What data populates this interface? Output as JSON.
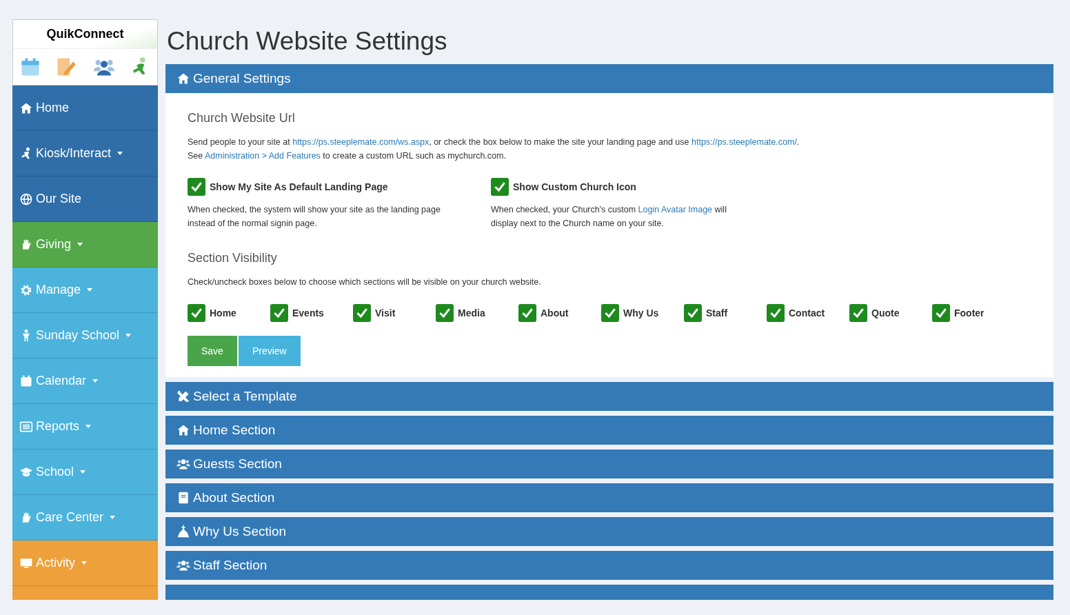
{
  "sidebar": {
    "brand": "QuikConnect",
    "items": [
      {
        "label": "Home",
        "kind": "house",
        "color": "#2f6ea8",
        "dropdown": false
      },
      {
        "label": "Kiosk/Interact",
        "kind": "kneel",
        "color": "#2f6ea8",
        "dropdown": true
      },
      {
        "label": "Our Site",
        "kind": "globe",
        "color": "#2f6ea8",
        "dropdown": false
      },
      {
        "label": "Giving",
        "kind": "hand",
        "color": "#55a84a",
        "dropdown": true
      },
      {
        "label": "Manage",
        "kind": "gear",
        "color": "#4bb3dc",
        "dropdown": true
      },
      {
        "label": "Sunday School",
        "kind": "child",
        "color": "#4bb3dc",
        "dropdown": true
      },
      {
        "label": "Calendar",
        "kind": "calendar",
        "color": "#4bb3dc",
        "dropdown": true
      },
      {
        "label": "Reports",
        "kind": "list",
        "color": "#4bb3dc",
        "dropdown": true
      },
      {
        "label": "School",
        "kind": "cap",
        "color": "#4bb3dc",
        "dropdown": true
      },
      {
        "label": "Care Center",
        "kind": "hand",
        "color": "#4bb3dc",
        "dropdown": true
      },
      {
        "label": "Activity",
        "kind": "monitor",
        "color": "#eea03a",
        "dropdown": true
      }
    ]
  },
  "page_title": "Church Website Settings",
  "general_settings": {
    "title": "General Settings",
    "url_heading": "Church Website Url",
    "url_text_1": "Send people to your site at ",
    "url_link_1": "https://ps.steeplemate.com/ws.aspx",
    "url_text_2": ", or check the box below to make the site your landing page and use ",
    "url_link_2": "https://ps.steeplemate.com/",
    "url_text_3": ".",
    "url_text_4": "See ",
    "url_link_3": "Administration > Add Features",
    "url_text_5": " to create a custom URL such as mychurch.com.",
    "options": [
      {
        "label": "Show My Site As Default Landing Page",
        "checked": true,
        "desc_1": "When checked, the system will show your site as the landing page instead of the normal signin page."
      },
      {
        "label": "Show Custom Church Icon",
        "checked": true,
        "desc_1": "When checked, your Church's custom ",
        "desc_link": "Login Avatar Image",
        "desc_2": " will display next to the Church name on your site."
      }
    ],
    "visibility_heading": "Section Visibility",
    "visibility_text": "Check/uncheck boxes below to choose which sections will be visible on your church website.",
    "sections": [
      {
        "label": "Home",
        "checked": true
      },
      {
        "label": "Events",
        "checked": true
      },
      {
        "label": "Visit",
        "checked": true
      },
      {
        "label": "Media",
        "checked": true
      },
      {
        "label": "About",
        "checked": true
      },
      {
        "label": "Why Us",
        "checked": true
      },
      {
        "label": "Staff",
        "checked": true
      },
      {
        "label": "Contact",
        "checked": true
      },
      {
        "label": "Quote",
        "checked": true
      },
      {
        "label": "Footer",
        "checked": true
      }
    ],
    "buttons": [
      {
        "label": "Save",
        "kind": "save"
      },
      {
        "label": "Preview",
        "kind": "preview"
      }
    ]
  },
  "panels": [
    {
      "title": "Select a Template",
      "kind": "pencil"
    },
    {
      "title": "Home Section",
      "kind": "house"
    },
    {
      "title": "Guests Section",
      "kind": "people"
    },
    {
      "title": "About Section",
      "kind": "book"
    },
    {
      "title": "Why Us Section",
      "kind": "church"
    },
    {
      "title": "Staff Section",
      "kind": "people"
    }
  ]
}
